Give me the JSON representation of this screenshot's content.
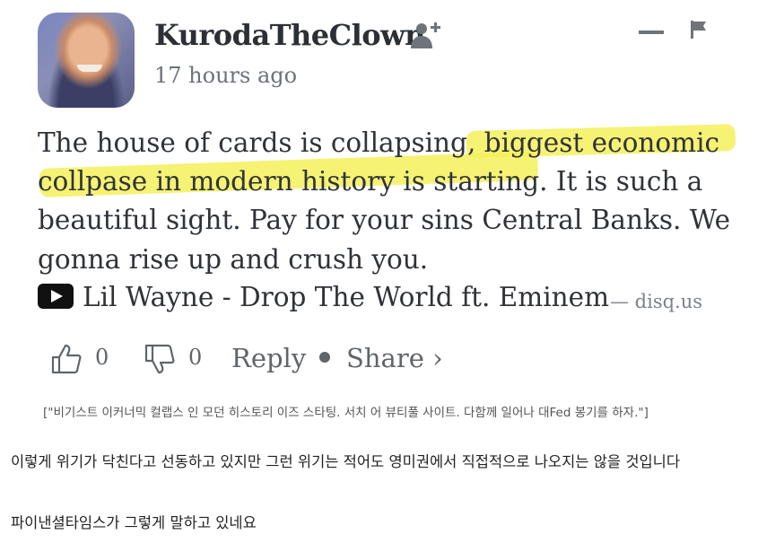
{
  "comment": {
    "username": "KurodaTheClown",
    "timestamp": "17 hours ago",
    "body_lines": [
      "The house of cards is collapsing, biggest economic",
      "collpase in modern history is starting. It is such a",
      "beautiful sight. Pay for your sins Central Banks. We",
      "gonna rise up and crush you."
    ],
    "embed": {
      "title": "Lil Wayne - Drop The World ft. Eminem",
      "source": "— disq.us"
    },
    "actions": {
      "upvote_count": "0",
      "downvote_count": "0",
      "reply_label": "Reply",
      "share_label": "Share ›"
    },
    "highlight_color": "#f4f05a"
  },
  "translation": "[\"비기스트 이커너믹 컬랩스 인 모던 히스토리 이즈 스타팅. 서치 어 뷰티풀 사이트. 다함께 일어나 대Fed 봉기를 하자.\"]",
  "paragraphs": [
    "이렇게 위기가 닥친다고 선동하고 있지만 그런 위기는 적어도 영미권에서 직접적으로 나오지는 않을 것입니다",
    "파이낸셜타임스가 그렇게 말하고 있네요"
  ]
}
